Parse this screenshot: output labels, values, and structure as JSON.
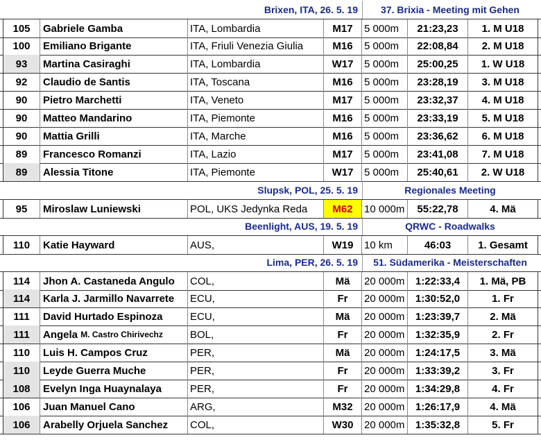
{
  "sections": [
    {
      "place": "Brixen, ITA,  26. 5. 19",
      "event": "37. Brixia - Meeting mit Gehen",
      "rows": [
        {
          "pts": "105",
          "name": "Gabriele Gamba",
          "nat": "ITA, Lombardia",
          "cat": "M17",
          "dist": "5 000m",
          "time": "21:23,23",
          "rank": "1. M U18",
          "shade": false
        },
        {
          "pts": "100",
          "name": "Emiliano Brigante",
          "nat": "ITA, Friuli Venezia Giulia",
          "cat": "M16",
          "dist": "5 000m",
          "time": "22:08,84",
          "rank": "2. M U18",
          "shade": false
        },
        {
          "pts": "93",
          "name": "Martina Casiraghi",
          "nat": "ITA, Lombardia",
          "cat": "W17",
          "dist": "5 000m",
          "time": "25:00,25",
          "rank": "1. W U18",
          "shade": true
        },
        {
          "pts": "92",
          "name": "Claudio de Santis",
          "nat": "ITA, Toscana",
          "cat": "M16",
          "dist": "5 000m",
          "time": "23:28,19",
          "rank": "3. M U18",
          "shade": false
        },
        {
          "pts": "90",
          "name": "Pietro Marchetti",
          "nat": "ITA, Veneto",
          "cat": "M17",
          "dist": "5 000m",
          "time": "23:32,37",
          "rank": "4. M U18",
          "shade": false
        },
        {
          "pts": "90",
          "name": "Matteo Mandarino",
          "nat": "ITA, Piemonte",
          "cat": "M16",
          "dist": "5 000m",
          "time": "23:33,19",
          "rank": "5. M U18",
          "shade": false
        },
        {
          "pts": "90",
          "name": "Mattia Grilli",
          "nat": "ITA, Marche",
          "cat": "M16",
          "dist": "5 000m",
          "time": "23:36,62",
          "rank": "6. M U18",
          "shade": false
        },
        {
          "pts": "89",
          "name": "Francesco Romanzi",
          "nat": "ITA, Lazio",
          "cat": "M17",
          "dist": "5 000m",
          "time": "23:41,08",
          "rank": "7. M U18",
          "shade": false
        },
        {
          "pts": "89",
          "name": "Alessia Titone",
          "nat": "ITA, Piemonte",
          "cat": "W17",
          "dist": "5 000m",
          "time": "25:40,61",
          "rank": "2. W U18",
          "shade": true
        }
      ]
    },
    {
      "place": "Slupsk, POL,  25. 5. 19",
      "event": "Regionales Meeting",
      "rows": [
        {
          "pts": "95",
          "name": "Miroslaw Luniewski",
          "nat": "POL, UKS Jedynka Reda",
          "cat": "M62",
          "dist": "10 000m",
          "time": "55:22,78",
          "rank": "4. Mä",
          "shade": false,
          "highlight": true
        }
      ]
    },
    {
      "place": "Beenlight, AUS,  19. 5. 19",
      "event": "QRWC - Roadwalks",
      "rows": [
        {
          "pts": "110",
          "name": "Katie Hayward",
          "nat": "AUS,",
          "cat": "W19",
          "dist": "10 km",
          "time": "46:03",
          "rank": "1. Gesamt",
          "shade": false
        }
      ]
    },
    {
      "place": "Lima, PER,  26. 5. 19",
      "event": "51. Südamerika - Meisterschaften",
      "rows": [
        {
          "pts": "114",
          "name": "Jhon A. Castaneda Angulo",
          "nat": "COL,",
          "cat": "Mä",
          "dist": "20 000m",
          "time": "1:22:33,4",
          "rank": "1. Mä, PB",
          "shade": false
        },
        {
          "pts": "114",
          "name": "Karla J. Jarmillo Navarrete",
          "nat": "ECU,",
          "cat": "Fr",
          "dist": "20 000m",
          "time": "1:30:52,0",
          "rank": "1. Fr",
          "shade": true
        },
        {
          "pts": "111",
          "name": "David Hurtado Espinoza",
          "nat": "ECU,",
          "cat": "Mä",
          "dist": "20 000m",
          "time": "1:23:39,7",
          "rank": "2. Mä",
          "shade": false
        },
        {
          "pts": "111",
          "name": "Angela",
          "name_small": "M. Castro Chirivechz",
          "nat": "BOL,",
          "cat": "Fr",
          "dist": "20 000m",
          "time": "1:32:35,9",
          "rank": "2. Fr",
          "shade": true
        },
        {
          "pts": "110",
          "name": "Luis H. Campos Cruz",
          "nat": "PER,",
          "cat": "Mä",
          "dist": "20 000m",
          "time": "1:24:17,5",
          "rank": "3. Mä",
          "shade": false
        },
        {
          "pts": "110",
          "name": "Leyde Guerra Muche",
          "nat": "PER,",
          "cat": "Fr",
          "dist": "20 000m",
          "time": "1:33:39,2",
          "rank": "3. Fr",
          "shade": true
        },
        {
          "pts": "108",
          "name": "Evelyn Inga Huaynalaya",
          "nat": "PER,",
          "cat": "Fr",
          "dist": "20 000m",
          "time": "1:34:29,8",
          "rank": "4. Fr",
          "shade": true
        },
        {
          "pts": "106",
          "name": "Juan Manuel Cano",
          "nat": "ARG,",
          "cat": "M32",
          "dist": "20 000m",
          "time": "1:26:17,9",
          "rank": "4. Mä",
          "shade": false
        },
        {
          "pts": "106",
          "name": "Arabelly Orjuela Sanchez",
          "nat": "COL,",
          "cat": "W30",
          "dist": "20 000m",
          "time": "1:35:32,8",
          "rank": "5. Fr",
          "shade": true
        }
      ]
    }
  ]
}
